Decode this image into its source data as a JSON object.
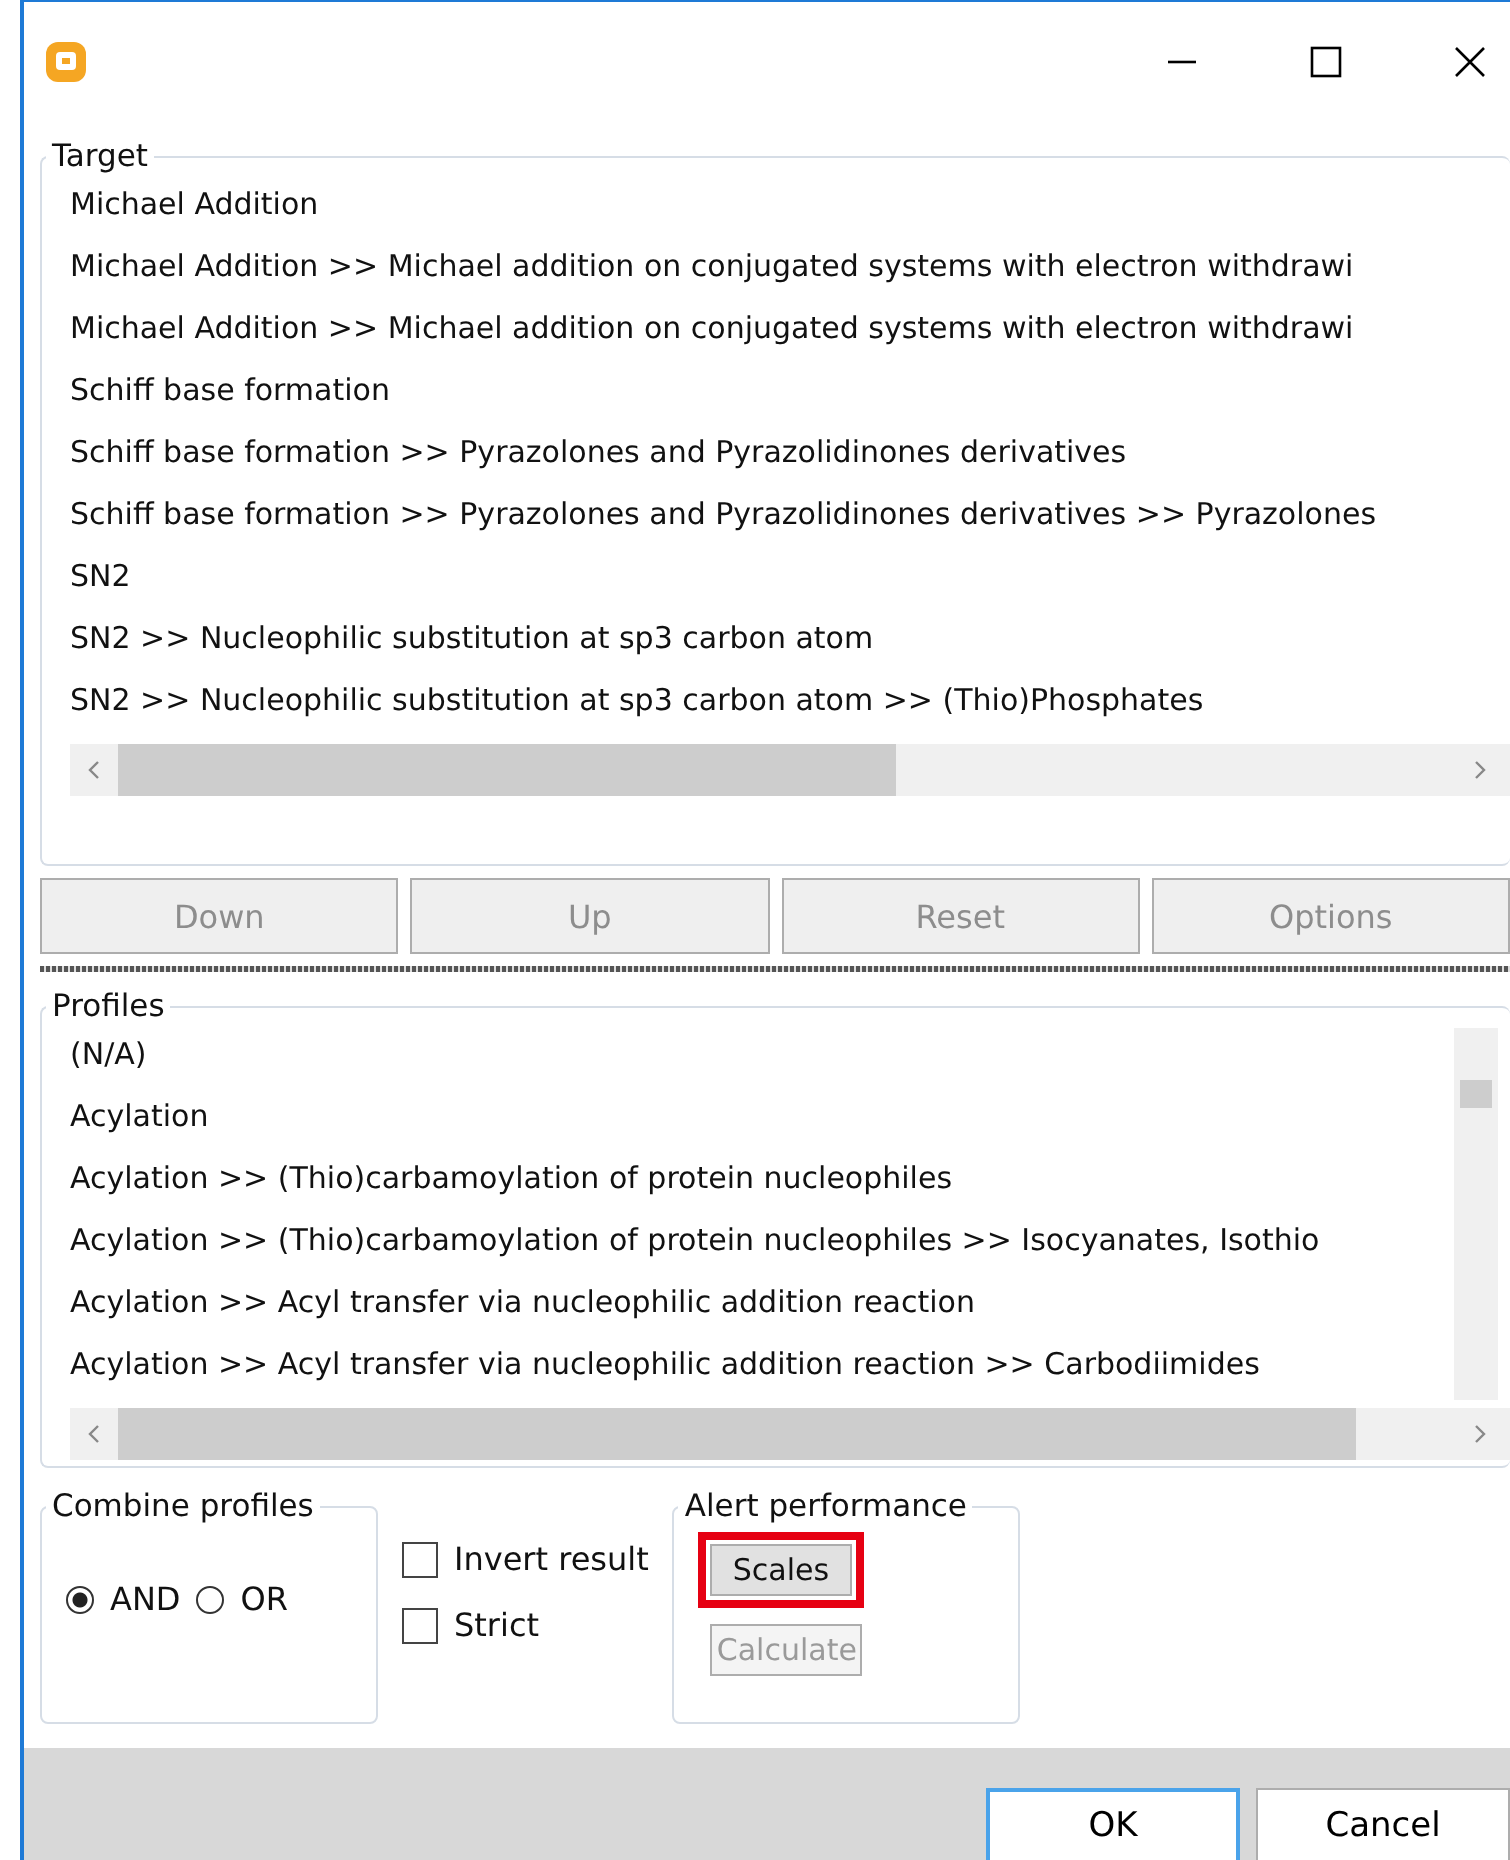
{
  "target": {
    "title": "Target",
    "items": [
      {
        "label": "Michael Addition",
        "selected": false
      },
      {
        "label": "Michael Addition >> Michael addition on conjugated systems with electron withdrawi",
        "selected": false
      },
      {
        "label": "Michael Addition >> Michael addition on conjugated systems with electron withdrawi",
        "selected": false
      },
      {
        "label": "Schiff base formation",
        "selected": false
      },
      {
        "label": "Schiff base formation >> Pyrazolones and Pyrazolidinones derivatives",
        "selected": false
      },
      {
        "label": "Schiff base formation >> Pyrazolones and Pyrazolidinones derivatives >> Pyrazolones",
        "selected": false
      },
      {
        "label": "SN2",
        "selected": false
      },
      {
        "label": "SN2 >> Nucleophilic substitution at sp3 carbon atom",
        "selected": false
      },
      {
        "label": "SN2 >> Nucleophilic substitution at sp3 carbon atom >> (Thio)Phosphates",
        "selected": false
      }
    ]
  },
  "order_buttons": [
    {
      "label": "Down",
      "disabled": true
    },
    {
      "label": "Up",
      "disabled": true
    },
    {
      "label": "Reset",
      "disabled": true
    },
    {
      "label": "Options",
      "disabled": true
    }
  ],
  "profiles": {
    "title": "Profiles",
    "items": [
      {
        "label": "(N/A)",
        "selected": false
      },
      {
        "label": "Acylation",
        "selected": false
      },
      {
        "label": "Acylation >> (Thio)carbamoylation of protein nucleophiles",
        "selected": false
      },
      {
        "label": "Acylation >> (Thio)carbamoylation of protein nucleophiles >> Isocyanates, Isothio",
        "selected": false
      },
      {
        "label": "Acylation >> Acyl transfer via nucleophilic addition reaction",
        "selected": false
      },
      {
        "label": "Acylation >> Acyl transfer via nucleophilic addition reaction >> Carbodiimides",
        "selected": false
      }
    ]
  },
  "combine": {
    "title": "Combine profiles",
    "options": [
      {
        "label": "AND",
        "selected": true
      },
      {
        "label": "OR",
        "selected": false
      }
    ]
  },
  "checkboxes": [
    {
      "label": "Invert result",
      "checked": false
    },
    {
      "label": "Strict",
      "checked": false
    }
  ],
  "alert_performance": {
    "title": "Alert performance",
    "buttons": [
      {
        "label": "Scales",
        "disabled": false,
        "highlighted": true
      },
      {
        "label": "Calculate",
        "disabled": true,
        "highlighted": false
      }
    ]
  },
  "dialog_buttons": [
    {
      "label": "OK",
      "default": true
    },
    {
      "label": "Cancel",
      "default": false
    }
  ]
}
